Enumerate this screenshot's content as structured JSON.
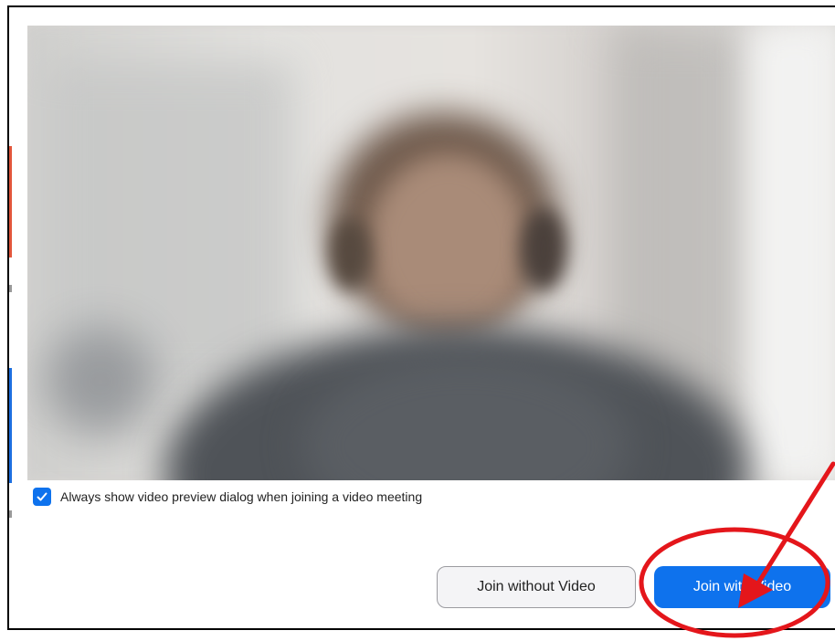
{
  "checkbox": {
    "label": "Always show video preview dialog when joining a video meeting",
    "checked": true
  },
  "buttons": {
    "join_without_video": "Join without Video",
    "join_with_video": "Join with Video"
  },
  "icons": {
    "checkbox_check": "checkmark-icon"
  },
  "colors": {
    "accent_blue": "#0e72ed",
    "annotation_red": "#e4161b",
    "left_strip_red": "#e2563b",
    "left_strip_blue": "#1d6fe0"
  }
}
